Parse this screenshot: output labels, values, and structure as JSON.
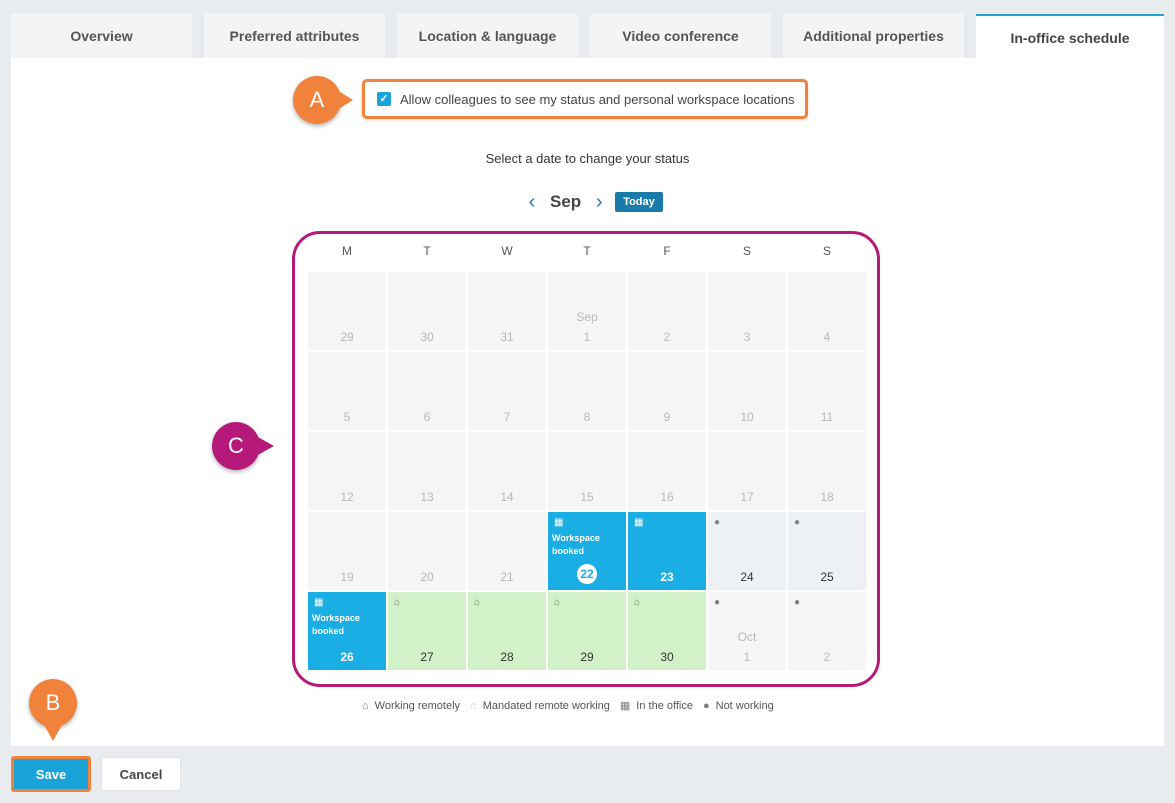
{
  "tabs": [
    {
      "label": "Overview",
      "active": false
    },
    {
      "label": "Preferred attributes",
      "active": false
    },
    {
      "label": "Location & language",
      "active": false
    },
    {
      "label": "Video conference",
      "active": false
    },
    {
      "label": "Additional properties",
      "active": false
    },
    {
      "label": "In-office schedule",
      "active": true
    }
  ],
  "consent": {
    "checked": true,
    "label": "Allow colleagues to see my status and personal workspace locations"
  },
  "callouts": {
    "a": "A",
    "b": "B",
    "c": "C"
  },
  "instruction": "Select a date to change your status",
  "nav": {
    "month": "Sep",
    "today_label": "Today",
    "prev_icon": "chevron-left-icon",
    "next_icon": "chevron-right-icon"
  },
  "weekdays": [
    "M",
    "T",
    "W",
    "T",
    "F",
    "S",
    "S"
  ],
  "calendar": [
    [
      {
        "day": "29",
        "status": "none"
      },
      {
        "day": "30",
        "status": "none"
      },
      {
        "day": "31",
        "status": "none"
      },
      {
        "day": "1",
        "month_label": "Sep",
        "status": "none"
      },
      {
        "day": "2",
        "status": "none"
      },
      {
        "day": "3",
        "status": "none"
      },
      {
        "day": "4",
        "status": "none"
      }
    ],
    [
      {
        "day": "5",
        "status": "none"
      },
      {
        "day": "6",
        "status": "none"
      },
      {
        "day": "7",
        "status": "none"
      },
      {
        "day": "8",
        "status": "none"
      },
      {
        "day": "9",
        "status": "none"
      },
      {
        "day": "10",
        "status": "none"
      },
      {
        "day": "11",
        "status": "none"
      }
    ],
    [
      {
        "day": "12",
        "status": "none"
      },
      {
        "day": "13",
        "status": "none"
      },
      {
        "day": "14",
        "status": "none"
      },
      {
        "day": "15",
        "status": "none"
      },
      {
        "day": "16",
        "status": "none"
      },
      {
        "day": "17",
        "status": "none"
      },
      {
        "day": "18",
        "status": "none"
      }
    ],
    [
      {
        "day": "19",
        "status": "none"
      },
      {
        "day": "20",
        "status": "none"
      },
      {
        "day": "21",
        "status": "none"
      },
      {
        "day": "22",
        "status": "office",
        "label": "Workspace booked",
        "today": true
      },
      {
        "day": "23",
        "status": "office"
      },
      {
        "day": "24",
        "status": "notworking"
      },
      {
        "day": "25",
        "status": "notworking"
      }
    ],
    [
      {
        "day": "26",
        "status": "office",
        "label": "Workspace booked"
      },
      {
        "day": "27",
        "status": "remote"
      },
      {
        "day": "28",
        "status": "remote"
      },
      {
        "day": "29",
        "status": "remote"
      },
      {
        "day": "30",
        "status": "remote"
      },
      {
        "day": "1",
        "month_label": "Oct",
        "status": "notworking",
        "faded": true
      },
      {
        "day": "2",
        "status": "notworking",
        "faded": true
      }
    ]
  ],
  "status_icons": {
    "office": "building-icon",
    "remote": "home-icon",
    "notworking": "location-pin-icon"
  },
  "legend": [
    {
      "icon": "home-icon",
      "label": "Working remotely"
    },
    {
      "icon": "home-outline-icon",
      "label": "Mandated remote working"
    },
    {
      "icon": "building-icon",
      "label": "In the office"
    },
    {
      "icon": "location-pin-icon",
      "label": "Not working"
    }
  ],
  "actions": {
    "save": "Save",
    "cancel": "Cancel"
  },
  "colors": {
    "accent": "#1aa3d9",
    "office": "#1aaee5",
    "remote": "#d3f1c8",
    "callout_orange": "#f0823c",
    "callout_magenta": "#b5197a"
  }
}
